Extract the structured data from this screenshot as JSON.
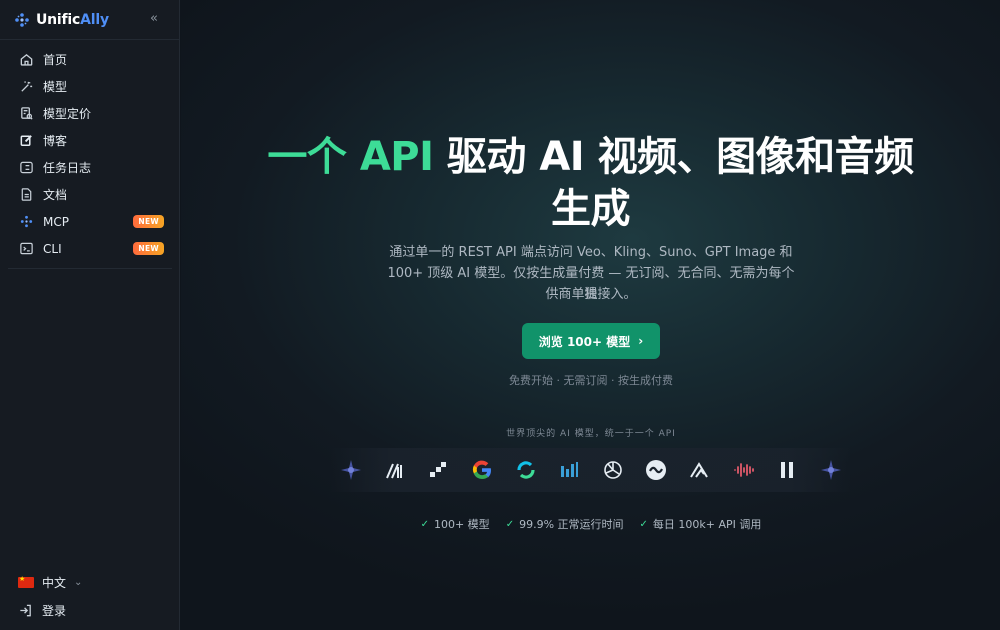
{
  "brand": {
    "name_prefix": "Unific",
    "name_accent": "Ally",
    "collapse_icon": "chevrons-left-icon"
  },
  "sidebar": {
    "items": [
      {
        "label": "首页",
        "icon": "home-icon"
      },
      {
        "label": "模型",
        "icon": "wand-icon"
      },
      {
        "label": "模型定价",
        "icon": "pricing-icon"
      },
      {
        "label": "博客",
        "icon": "edit-icon"
      },
      {
        "label": "任务日志",
        "icon": "list-icon"
      },
      {
        "label": "文档",
        "icon": "document-icon"
      },
      {
        "label": "MCP",
        "icon": "mcp-icon",
        "badge": "NEW"
      },
      {
        "label": "CLI",
        "icon": "terminal-icon",
        "badge": "NEW"
      }
    ],
    "language": "中文",
    "login": "登录"
  },
  "hero": {
    "title_part1_green": "一个 API",
    "title_part1_white": " 驱动 AI 视频、图像和音频",
    "title_part2": "生成",
    "subtitle_line1": "通过单一的 REST API 端点访问 Veo、Kling、Suno、GPT Image 和",
    "subtitle_line2": "100+ 顶级 AI 模型。仅按生成量付费 — 无订阅、无合同、无需为每个提",
    "subtitle_line3": "供商单独接入。",
    "cta_label": "浏览 100+ 模型",
    "cta_note": "免费开始 · 无需订阅 · 按生成付费",
    "models_caption": "世界顶尖的 AI 模型，统一于一个 API",
    "stats": [
      "100+ 模型",
      "99.9% 正常运行时间",
      "每日 100k+ API 调用"
    ]
  },
  "colors": {
    "accent_green": "#3ddc97",
    "cta_green": "#11936a",
    "brand_blue": "#4f8ff7",
    "badge_orange": "#ff6b3d"
  },
  "provider_logos": [
    "gemini-star-icon",
    "midjourney-icon",
    "pixel-icon",
    "google-icon",
    "ring-icon",
    "bars-icon",
    "openai-icon",
    "wave-s-icon",
    "mountain-icon",
    "audio-wave-icon",
    "pause-icon",
    "gemini-star-icon"
  ]
}
